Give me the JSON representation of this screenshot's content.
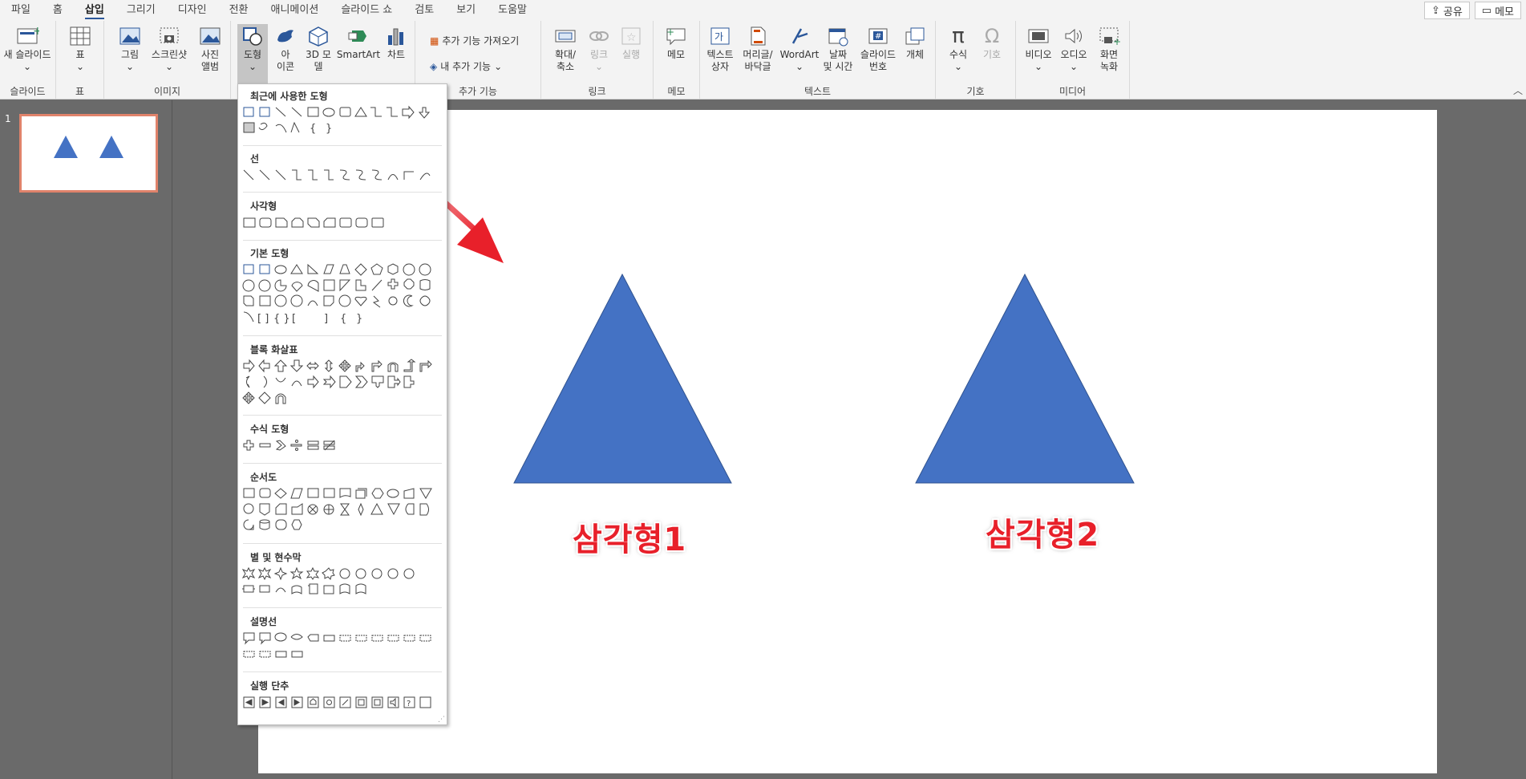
{
  "menu": {
    "tabs": [
      "파일",
      "홈",
      "삽입",
      "그리기",
      "디자인",
      "전환",
      "애니메이션",
      "슬라이드 쇼",
      "검토",
      "보기",
      "도움말"
    ],
    "active_tab": "삽입",
    "share_label": "공유",
    "memo_label": "메모"
  },
  "ribbon": {
    "slides": {
      "new_slide": "새 슬라이드",
      "group": "슬라이드"
    },
    "tables": {
      "table": "표",
      "group": "표"
    },
    "images": {
      "picture": "그림",
      "screenshot": "스크린샷",
      "album_line1": "사진",
      "album_line2": "앨범",
      "group": "이미지"
    },
    "illustrations": {
      "shapes": "도형",
      "icons_line1": "아",
      "icons_line2": "이콘",
      "model_line1": "3D 모",
      "model_line2": "델",
      "smartart": "SmartArt",
      "chart": "차트"
    },
    "addins": {
      "get": "추가 기능 가져오기",
      "my": "내 추가 기능",
      "group": "추가 기능"
    },
    "links": {
      "zoom_line1": "확대/",
      "zoom_line2": "축소",
      "link": "링크",
      "action": "실행",
      "group": "링크"
    },
    "comments": {
      "memo": "메모",
      "group": "메모"
    },
    "text": {
      "textbox_line1": "텍스트",
      "textbox_line2": "상자",
      "header_line1": "머리글/",
      "header_line2": "바닥글",
      "wordart": "WordArt",
      "date_line1": "날짜",
      "date_line2": "및 시간",
      "slidenum_line1": "슬라이드",
      "slidenum_line2": "번호",
      "object": "개체",
      "group": "텍스트"
    },
    "symbols": {
      "equation": "수식",
      "symbol": "기호",
      "group": "기호"
    },
    "media": {
      "video": "비디오",
      "audio": "오디오",
      "rec_line1": "화면",
      "rec_line2": "녹화",
      "group": "미디어"
    }
  },
  "thumbnails": {
    "slide_number": "1"
  },
  "slide": {
    "label1": "삼각형1",
    "label2": "삼각형2",
    "triangle_color": "#4472c4",
    "label_color": "#e8202a"
  },
  "shapes_menu": {
    "sections": [
      "최근에 사용한 도형",
      "선",
      "사각형",
      "기본 도형",
      "블록 화살표",
      "수식 도형",
      "순서도",
      "별 및 현수막",
      "설명선",
      "실행 단추"
    ]
  },
  "colors": {
    "accent": "#2b579a",
    "arrow": "#e8202a"
  }
}
